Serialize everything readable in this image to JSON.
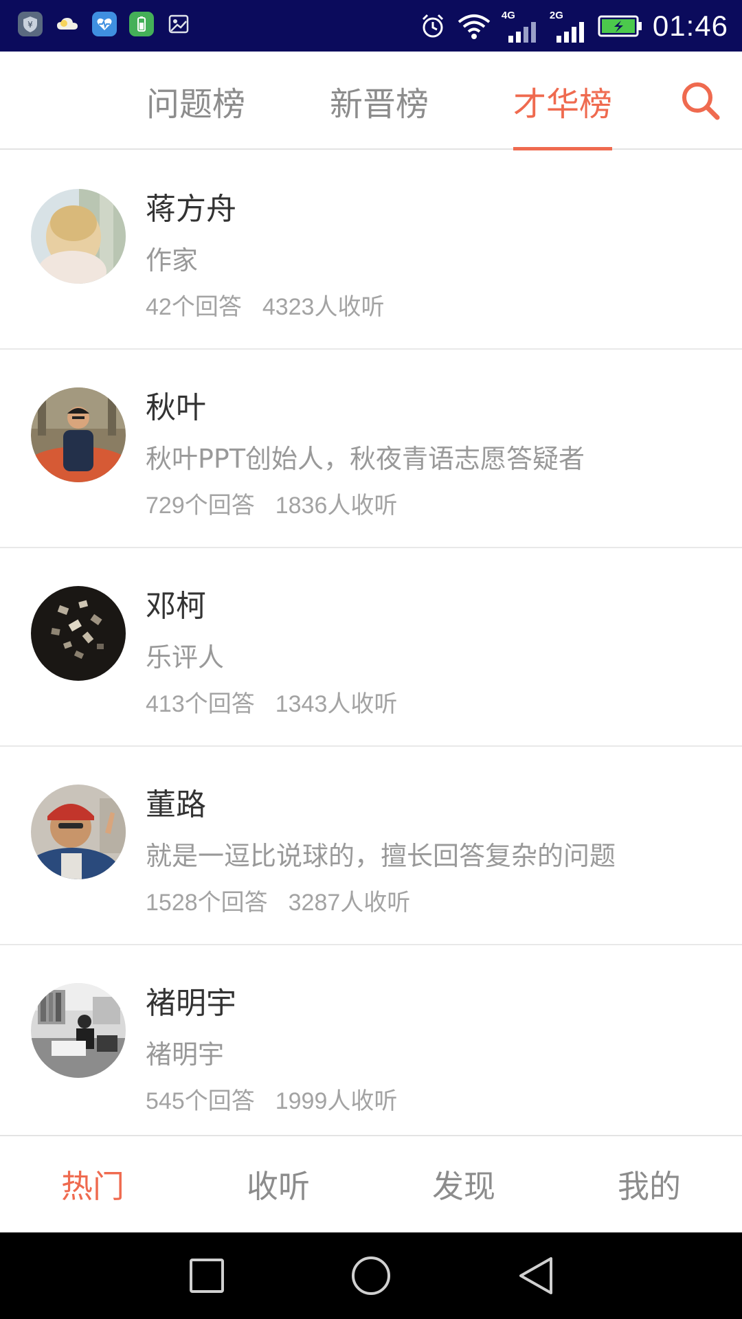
{
  "status_bar": {
    "time": "01:46",
    "network_primary": "4G",
    "network_secondary": "2G",
    "icons": [
      "shield-app-icon",
      "cloud-icon",
      "health-app-icon",
      "battery-app-icon",
      "gallery-app-icon",
      "alarm-icon",
      "wifi-icon",
      "signal-icon",
      "battery-charging-icon"
    ]
  },
  "top_tabs": {
    "items": [
      {
        "label": "问题榜",
        "active": false
      },
      {
        "label": "新晋榜",
        "active": false
      },
      {
        "label": "才华榜",
        "active": true
      }
    ],
    "search_icon": "search-icon"
  },
  "list": {
    "items": [
      {
        "name": "蒋方舟",
        "desc": "作家",
        "answers": "42个回答",
        "listeners": "4323人收听"
      },
      {
        "name": "秋叶",
        "desc": "秋叶PPT创始人，秋夜青语志愿答疑者",
        "answers": "729个回答",
        "listeners": "1836人收听"
      },
      {
        "name": "邓柯",
        "desc": "乐评人",
        "answers": "413个回答",
        "listeners": "1343人收听"
      },
      {
        "name": "董路",
        "desc": "就是一逗比说球的，擅长回答复杂的问题",
        "answers": "1528个回答",
        "listeners": "3287人收听"
      },
      {
        "name": "褚明宇",
        "desc": "褚明宇",
        "answers": "545个回答",
        "listeners": "1999人收听"
      }
    ]
  },
  "bottom_nav": {
    "items": [
      {
        "label": "热门",
        "active": true
      },
      {
        "label": "收听",
        "active": false
      },
      {
        "label": "发现",
        "active": false
      },
      {
        "label": "我的",
        "active": false
      }
    ]
  },
  "colors": {
    "accent": "#ef6a4f",
    "status_bar_bg": "#0b0b5c",
    "text_primary": "#333333",
    "text_secondary": "#999999"
  }
}
